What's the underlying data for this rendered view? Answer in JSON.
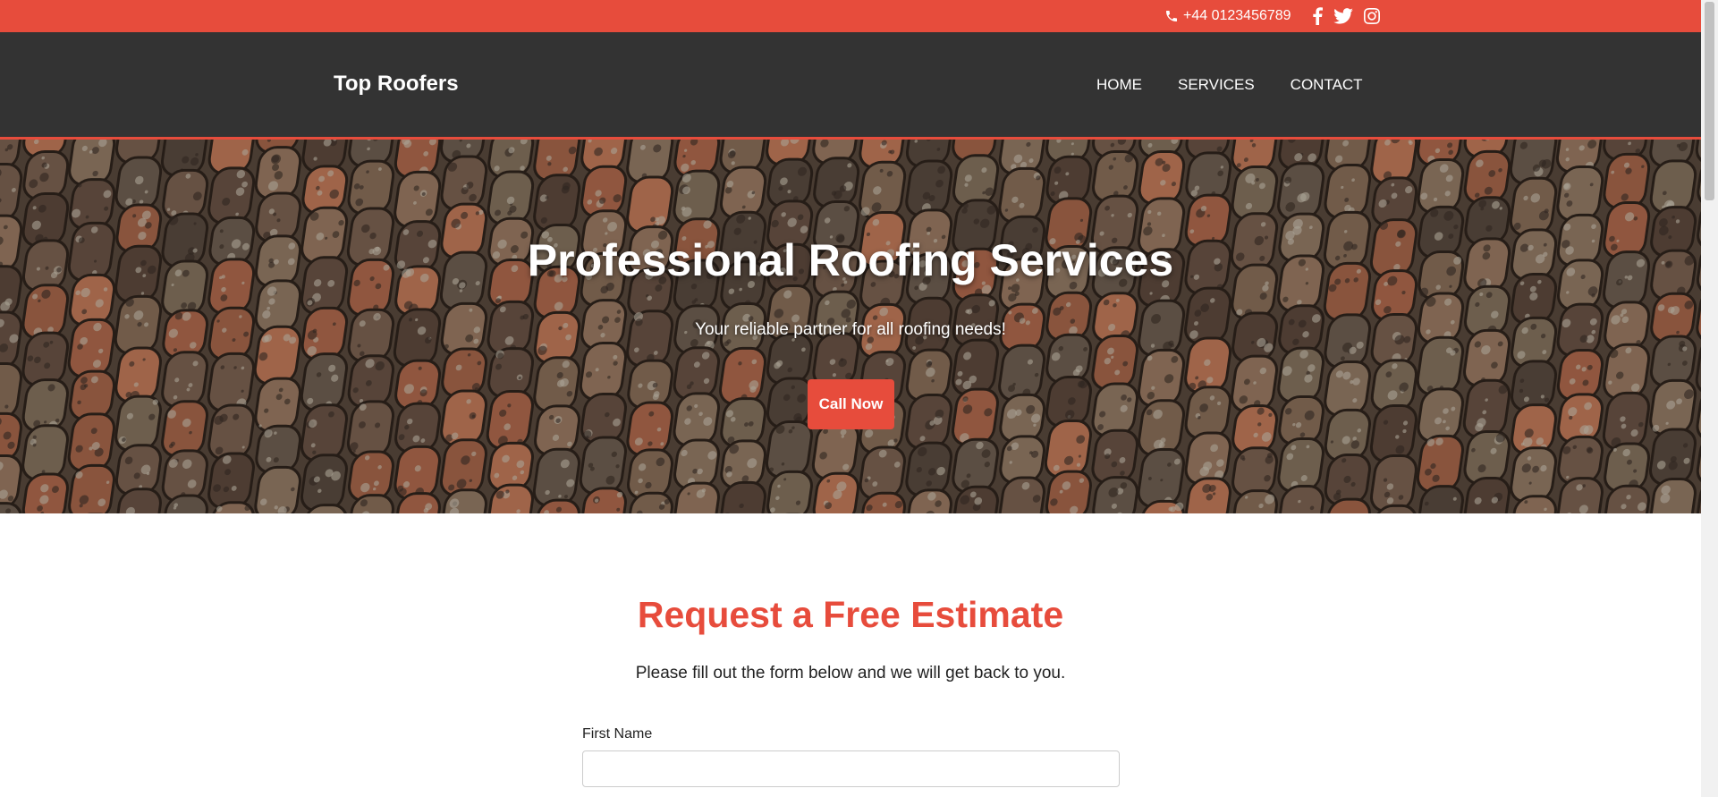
{
  "topbar": {
    "phone": "+44 0123456789",
    "social": [
      "facebook-icon",
      "twitter-icon",
      "instagram-icon"
    ],
    "bg_color": "#e74c3c"
  },
  "header": {
    "logo": "Top Roofers",
    "nav": [
      {
        "label": "HOME"
      },
      {
        "label": "SERVICES"
      },
      {
        "label": "CONTACT"
      }
    ],
    "bg_color": "#333333"
  },
  "hero": {
    "title": "Professional Roofing Services",
    "subtitle": "Your reliable partner for all roofing needs!",
    "button": "Call Now"
  },
  "estimate": {
    "title": "Request a Free Estimate",
    "subtitle": "Please fill out the form below and we will get back to you.",
    "fields": [
      {
        "label": "First Name",
        "value": "",
        "placeholder": ""
      }
    ]
  },
  "colors": {
    "accent": "#e74c3c",
    "dark": "#333333"
  }
}
